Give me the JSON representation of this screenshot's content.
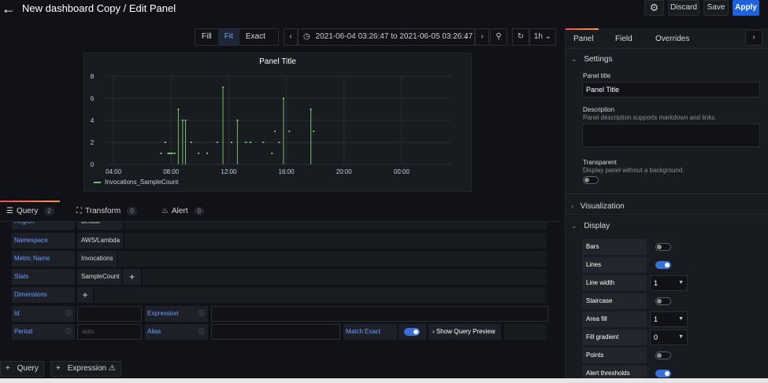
{
  "header": {
    "title": "New dashboard Copy / Edit Panel",
    "discard_label": "Discard",
    "save_label": "Save",
    "apply_label": "Apply"
  },
  "toolbar": {
    "fill_label": "Fill",
    "fit_label": "Fit",
    "exact_label": "Exact",
    "time_range": "2021-06-04 03:26:47 to 2021-06-05 03:26:47",
    "refresh_interval": "1h"
  },
  "panel": {
    "title": "Panel Title"
  },
  "chart_data": {
    "type": "scatter",
    "title": "Panel Title",
    "x_ticks": [
      "04:00",
      "08:00",
      "12:00",
      "16:00",
      "20:00",
      "00:00"
    ],
    "y_ticks": [
      0,
      2,
      4,
      6,
      8
    ],
    "ylim": [
      0,
      8
    ],
    "xlim_hours": [
      3.45,
      27.45
    ],
    "grid": true,
    "legend_position": "bottom-left",
    "series": [
      {
        "name": "Invocations_SampleCount",
        "color": "#73bf69",
        "x": [
          7.3,
          7.6,
          7.8,
          7.9,
          8.0,
          8.1,
          8.25,
          8.5,
          8.8,
          9.0,
          9.4,
          9.9,
          10.5,
          11.2,
          11.6,
          12.2,
          12.6,
          13.2,
          13.5,
          14.4,
          15.0,
          15.2,
          15.5,
          15.8,
          16.2,
          17.7,
          17.9
        ],
        "values": [
          1,
          2,
          1,
          1,
          1,
          1,
          1,
          5,
          4,
          4,
          2,
          1,
          1,
          2,
          7,
          2,
          4,
          2,
          2,
          2,
          1,
          3,
          2,
          6,
          3,
          5,
          3
        ]
      }
    ]
  },
  "query_tabs": {
    "query_label": "Query",
    "query_count": "2",
    "transform_label": "Transform",
    "transform_count": "0",
    "alert_label": "Alert",
    "alert_count": "0"
  },
  "query": {
    "region_label": "Region",
    "region_value": "default",
    "namespace_label": "Namespace",
    "namespace_value": "AWS/Lambda",
    "metric_label": "Metric Name",
    "metric_value": "Invocations",
    "stats_label": "Stats",
    "stats_value": "SampleCount",
    "dimensions_label": "Dimensions",
    "id_label": "Id",
    "expression_label": "Expression",
    "period_label": "Period",
    "period_placeholder": "auto",
    "alias_label": "Alias",
    "match_exact_label": "Match Exact",
    "show_preview_label": "Show Query Preview"
  },
  "bottom": {
    "add_query_label": "Query",
    "add_expression_label": "Expression"
  },
  "options": {
    "tabs": [
      "Panel",
      "Field",
      "Overrides"
    ],
    "settings_label": "Settings",
    "panel_title_label": "Panel title",
    "panel_title_value": "Panel Title",
    "description_label": "Description",
    "description_help": "Panel description supports markdown and links.",
    "transparent_label": "Transparent",
    "transparent_help": "Display panel without a background.",
    "visualization_label": "Visualization",
    "display_label": "Display",
    "display_rows": [
      {
        "label": "Bars",
        "kind": "toggle",
        "on": false
      },
      {
        "label": "Lines",
        "kind": "toggle",
        "on": true
      },
      {
        "label": "Line width",
        "kind": "select",
        "value": "1"
      },
      {
        "label": "Staircase",
        "kind": "toggle",
        "on": false
      },
      {
        "label": "Area fill",
        "kind": "select",
        "value": "1"
      },
      {
        "label": "Fill gradient",
        "kind": "select",
        "value": "0"
      },
      {
        "label": "Points",
        "kind": "toggle",
        "on": false
      },
      {
        "label": "Alert thresholds",
        "kind": "toggle",
        "on": true
      }
    ]
  }
}
